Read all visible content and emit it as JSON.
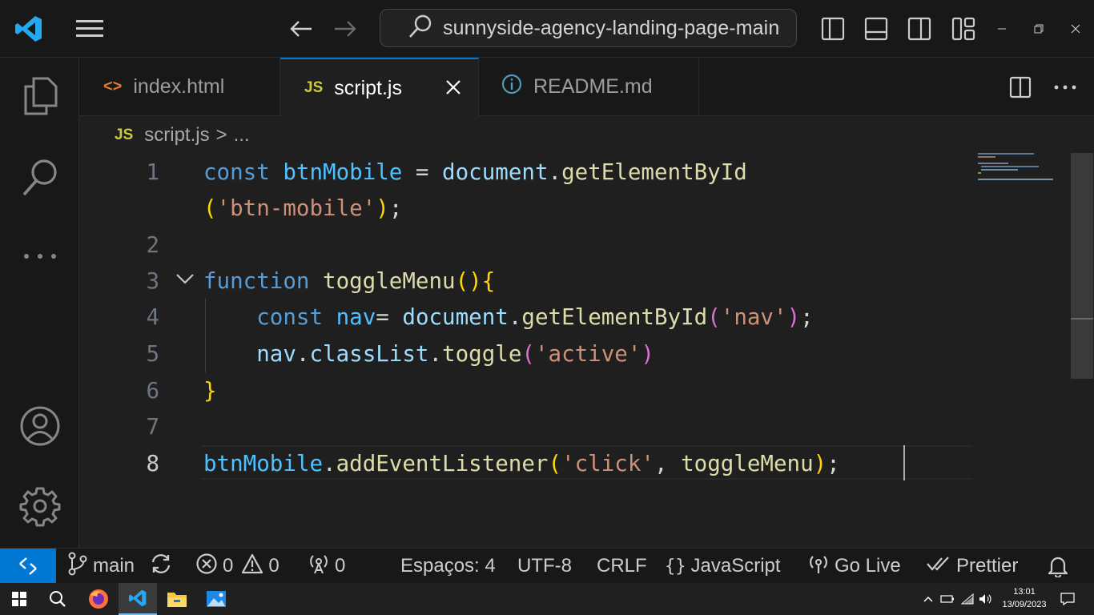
{
  "titlebar": {
    "search_text": "sunnyside-agency-landing-page-main"
  },
  "tabs": [
    {
      "icon_text": "<>",
      "label": "index.html",
      "color": "#e37933"
    },
    {
      "icon_text": "JS",
      "label": "script.js",
      "color": "#cbcb41"
    },
    {
      "icon_text": "i",
      "label": "README.md",
      "color": "#519aba"
    }
  ],
  "breadcrumb": {
    "icon_text": "JS",
    "file": "script.js",
    "separator": ">",
    "more": "..."
  },
  "editor": {
    "line_numbers": [
      "1",
      "",
      "2",
      "3",
      "4",
      "5",
      "6",
      "7",
      "8"
    ],
    "lines": [
      [
        [
          "kw",
          "const"
        ],
        [
          "pn",
          " "
        ],
        [
          "obj",
          "btnMobile"
        ],
        [
          "pn",
          " = "
        ],
        [
          "var",
          "document"
        ],
        [
          "pn",
          "."
        ],
        [
          "fn",
          "getElementById"
        ]
      ],
      [
        [
          "b1",
          "("
        ],
        [
          "str",
          "'btn-mobile'"
        ],
        [
          "b1",
          ")"
        ],
        [
          "pn",
          ";"
        ]
      ],
      [],
      [
        [
          "kw",
          "function"
        ],
        [
          "pn",
          " "
        ],
        [
          "fn",
          "toggleMenu"
        ],
        [
          "b1",
          "()"
        ],
        [
          "b1",
          "{"
        ]
      ],
      [
        [
          "pn",
          "    "
        ],
        [
          "kw",
          "const"
        ],
        [
          "pn",
          " "
        ],
        [
          "obj",
          "nav"
        ],
        [
          "pn",
          "= "
        ],
        [
          "var",
          "document"
        ],
        [
          "pn",
          "."
        ],
        [
          "fn",
          "getElementById"
        ],
        [
          "b2",
          "("
        ],
        [
          "str",
          "'nav'"
        ],
        [
          "b2",
          ")"
        ],
        [
          "pn",
          ";"
        ]
      ],
      [
        [
          "pn",
          "    "
        ],
        [
          "var",
          "nav"
        ],
        [
          "pn",
          "."
        ],
        [
          "var",
          "classList"
        ],
        [
          "pn",
          "."
        ],
        [
          "fn",
          "toggle"
        ],
        [
          "b2",
          "("
        ],
        [
          "str",
          "'active'"
        ],
        [
          "b2",
          ")"
        ]
      ],
      [
        [
          "b1",
          "}"
        ]
      ],
      [],
      [
        [
          "obj",
          "btnMobile"
        ],
        [
          "pn",
          "."
        ],
        [
          "fn",
          "addEventListener"
        ],
        [
          "b1",
          "("
        ],
        [
          "str",
          "'click'"
        ],
        [
          "pn",
          ", "
        ],
        [
          "fn",
          "toggleMenu"
        ],
        [
          "b1",
          ")"
        ],
        [
          "pn",
          ";"
        ]
      ]
    ]
  },
  "statusbar": {
    "branch": "main",
    "errors": "0",
    "warnings": "0",
    "ports": "0",
    "indent": "Espaços: 4",
    "encoding": "UTF-8",
    "eol": "CRLF",
    "language": "JavaScript",
    "golive": "Go Live",
    "prettier": "Prettier"
  },
  "taskbar": {
    "time": "13:01",
    "date": "13/09/2023"
  },
  "colors": {
    "accent": "#0078d4",
    "background": "#1f1f1f",
    "chrome": "#181818"
  }
}
